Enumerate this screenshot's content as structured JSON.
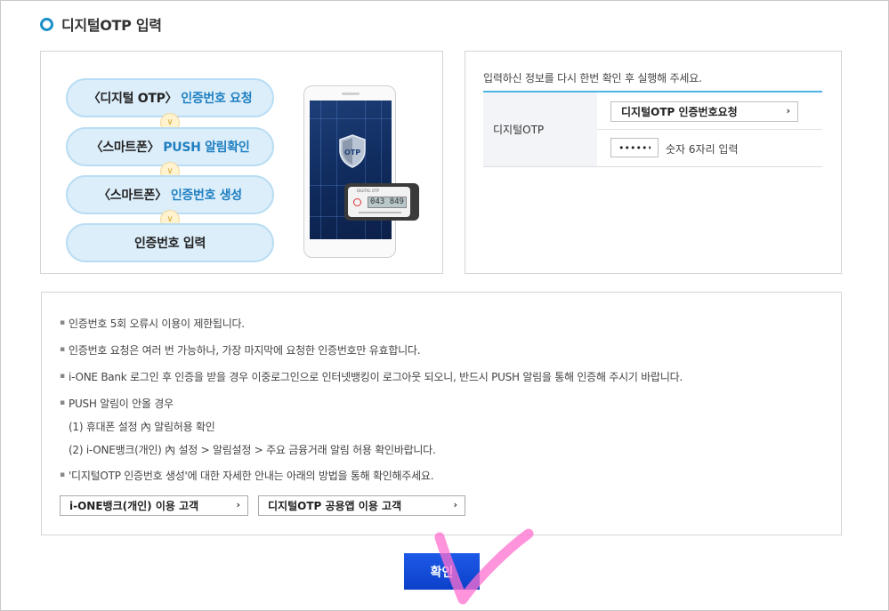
{
  "title": "디지털OTP 입력",
  "steps": [
    {
      "prefix": "〈디지털 OTP〉",
      "highlight": "인증번호 요청"
    },
    {
      "prefix": "〈스마트폰〉",
      "highlight": "PUSH 알림확인"
    },
    {
      "prefix": "〈스마트폰〉",
      "highlight": "인증번호 생성"
    },
    {
      "prefix": "인증번호 입력",
      "highlight": ""
    }
  ],
  "illustration": {
    "shield_label": "OTP",
    "device_brand": "DIGITAL OTP",
    "device_digits": "043 849"
  },
  "form": {
    "info": "입력하신 정보를 다시 한번 확인 후 실행해 주세요.",
    "label": "디지털OTP",
    "request_button": "디지털OTP 인증번호요청",
    "otp_value": "••••••",
    "hint": "숫자 6자리 입력"
  },
  "notices": [
    "인증번호 5회 오류시 이용이 제한됩니다.",
    "인증번호 요청은 여러 번 가능하나, 가장 마지막에 요청한 인증번호만 유효합니다.",
    "i-ONE Bank 로그인 후 인증을 받을 경우 이중로그인으로 인터넷뱅킹이 로그아웃 되오니, 반드시 PUSH 알림을 통해 인증해 주시기 바랍니다.",
    "PUSH 알림이 안올 경우",
    "'디지털OTP 인증번호 생성'에 대한 자세한 안내는 아래의 방법을 통해 확인해주세요."
  ],
  "push_subs": [
    "(1) 휴대폰 설정 內 알림허용 확인",
    "(2) i-ONE뱅크(개인) 內 설정 > 알림설정 > 주요 금융거래 알림 허용 확인바랍니다."
  ],
  "link_buttons": [
    "i-ONE뱅크(개인) 이용 고객",
    "디지털OTP 공용앱 이용 고객"
  ],
  "arrow": "›",
  "confirm_label": "확인",
  "colors": {
    "accent": "#1f7fc1",
    "confirm": "#1450dc",
    "step_bg": "#dceefa",
    "table_top": "#4db3e6",
    "annotation": "#ff6fd0"
  }
}
